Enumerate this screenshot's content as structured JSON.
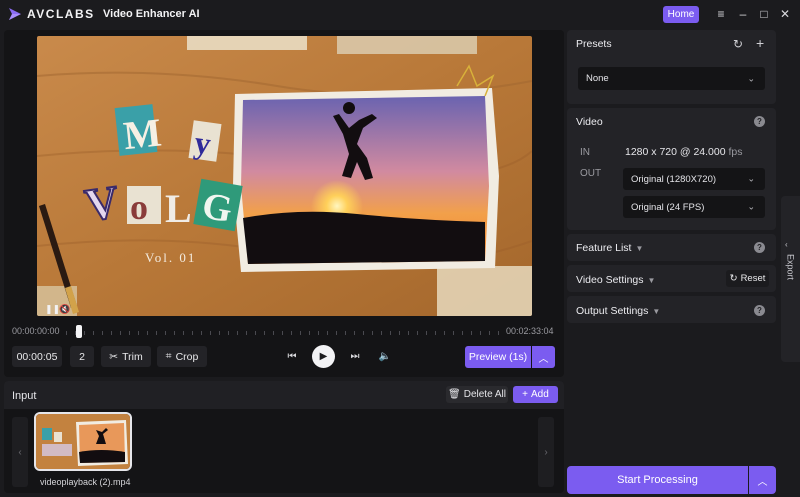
{
  "titlebar": {
    "brand": "AVCLABS",
    "app_name": "Video Enhancer AI",
    "home_label": "Home"
  },
  "preview": {
    "time_start": "00:00:00:00",
    "time_end": "00:02:33:04",
    "progress": 0.03,
    "current_time": "00:00:05",
    "frame_step": "2",
    "trim_label": "Trim",
    "crop_label": "Crop",
    "preview_label": "Preview (1s)",
    "overlay": {
      "title_line1": "My",
      "title_line2": "VOLG",
      "vol": "Vol. 01"
    }
  },
  "input": {
    "title": "Input",
    "delete_all_label": "Delete All",
    "add_label": "Add",
    "files": [
      {
        "name": "videoplayback (2).mp4"
      }
    ]
  },
  "presets": {
    "title": "Presets",
    "selected": "None"
  },
  "video": {
    "title": "Video",
    "in_label": "IN",
    "in_value": "1280 x 720 @ 24.000",
    "in_unit": "fps",
    "out_label": "OUT",
    "out_resolution": "Original (1280X720)",
    "out_fps": "Original (24 FPS)"
  },
  "sections": {
    "feature_list": "Feature List",
    "video_settings": "Video Settings",
    "reset_label": "Reset",
    "output_settings": "Output Settings"
  },
  "export_label": "Export",
  "start_label": "Start Processing",
  "colors": {
    "accent": "#7b5cf0",
    "panel": "#232327",
    "background": "#1b1b1e"
  }
}
